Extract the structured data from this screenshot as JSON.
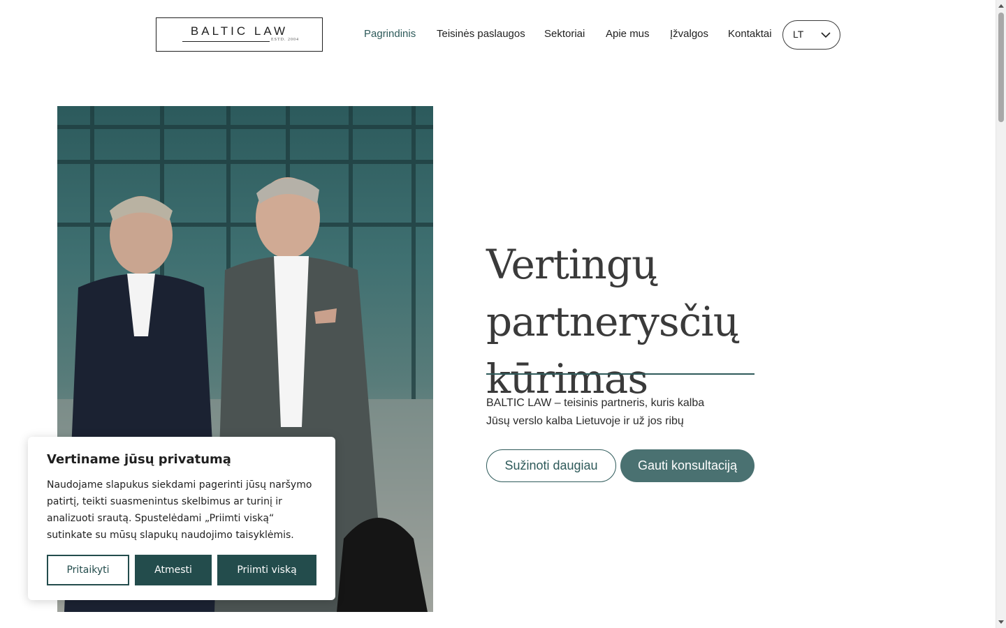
{
  "header": {
    "logo_text": "BALTIC LAW",
    "logo_estd": "ESTD. 2004",
    "nav": [
      {
        "label": "Pagrindinis",
        "active": true
      },
      {
        "label": "Teisinės paslaugos",
        "active": false
      },
      {
        "label": "Sektoriai",
        "active": false
      },
      {
        "label": "Apie mus",
        "active": false
      },
      {
        "label": "Įžvalgos",
        "active": false
      },
      {
        "label": "Kontaktai",
        "active": false
      }
    ],
    "language": "LT"
  },
  "hero": {
    "title_line1": "Vertingų partnerysčių",
    "title_line2": "kūrimas",
    "subtitle_line1": "BALTIC LAW – teisinis partneris, kuris kalba",
    "subtitle_line2": "Jūsų verslo kalba Lietuvoje ir už jos ribų",
    "button_more": "Sužinoti daugiau",
    "button_consult": "Gauti konsultaciją"
  },
  "cookie_banner": {
    "title": "Vertiname jūsų privatumą",
    "text": "Naudojame slapukus siekdami pagerinti jūsų naršymo patirtį, teikti suasmenintus skelbimus ar turinį ir analizuoti srautą. Spustelėdami „Priimti viską“ sutinkate su mūsų slapukų naudojimo taisyklėmis.",
    "customize_label": "Pritaikyti",
    "reject_label": "Atmesti",
    "accept_label": "Priimti viską"
  },
  "colors": {
    "accent": "#2e5a5a",
    "button_fill": "#4a7171",
    "cookie_button": "#234c4c",
    "title_text": "#3a3a3a"
  }
}
